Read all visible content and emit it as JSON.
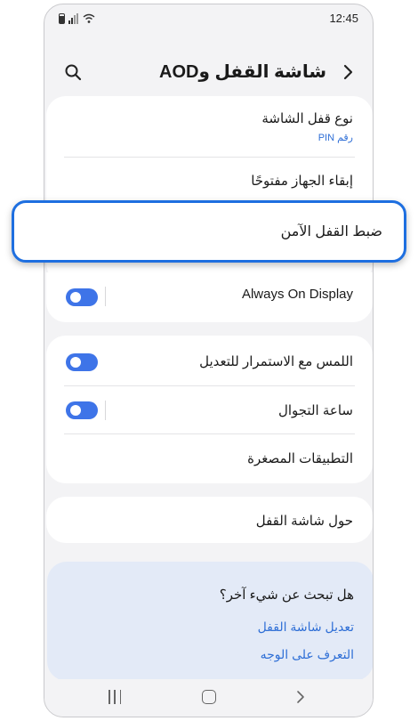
{
  "status": {
    "time": "12:45"
  },
  "header": {
    "title": "شاشة القفل وAOD",
    "back_icon": "chevron-right-icon",
    "search_icon": "search-icon"
  },
  "settings": {
    "lock_type_label": "نوع قفل الشاشة",
    "lock_type_value": "رقم PIN",
    "keep_unlocked_label": "إبقاء الجهاز مفتوحًا",
    "secure_lock_label": "ضبط القفل الآمن",
    "aod_label": "Always On Display",
    "aod_enabled": true,
    "touch_hold_label": "اللمس مع الاستمرار للتعديل",
    "touch_hold_enabled": true,
    "roaming_clock_label": "ساعة التجوال",
    "roaming_clock_enabled": true,
    "widgets_label": "التطبيقات المصغرة",
    "about_label": "حول شاشة القفل"
  },
  "suggestions": {
    "title": "هل تبحث عن شيء آخر؟",
    "links": [
      "تعديل شاشة القفل",
      "التعرف على الوجه"
    ]
  },
  "colors": {
    "accent": "#3e74e8",
    "link": "#2f6fd6",
    "highlight_border": "#1e6fe0",
    "suggest_bg": "#e3eaf7"
  }
}
